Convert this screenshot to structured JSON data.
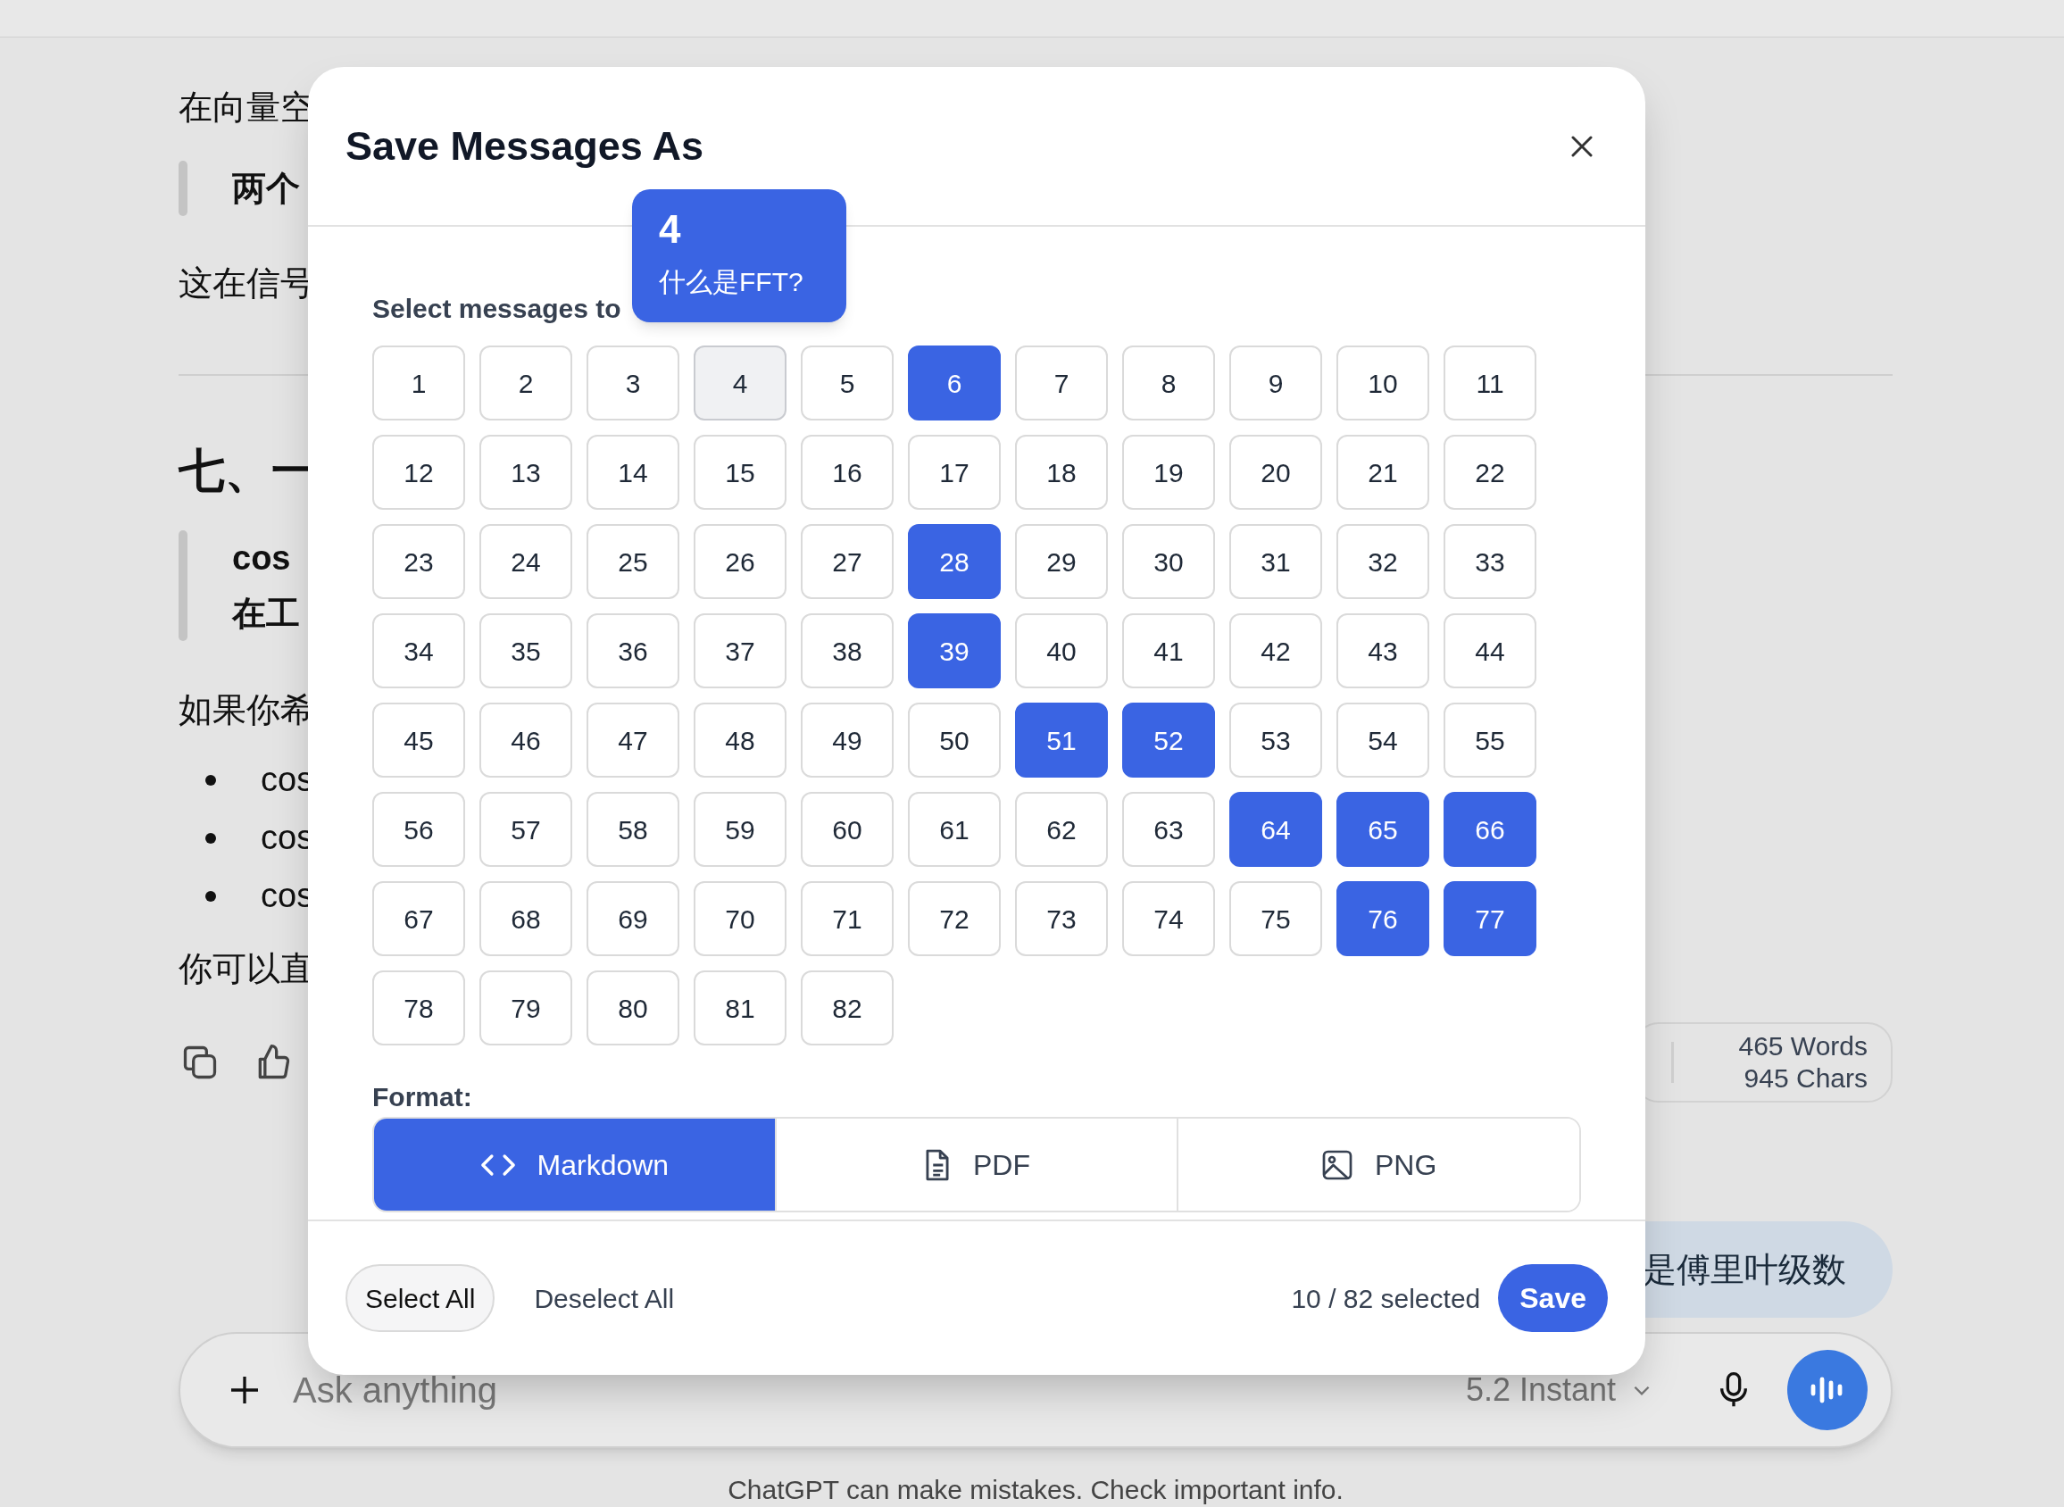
{
  "conversation": {
    "blocks": [
      {
        "kind": "para",
        "text": "在向量空"
      },
      {
        "kind": "quote",
        "lines": [
          "两个"
        ]
      },
      {
        "kind": "para",
        "text": "这在信号"
      },
      {
        "kind": "rule"
      },
      {
        "kind": "heading",
        "text": "七、一"
      },
      {
        "kind": "quote",
        "lines": [
          "cos",
          "在工"
        ]
      },
      {
        "kind": "para",
        "text": "如果你希"
      },
      {
        "kind": "bullets",
        "items": [
          "cos",
          "cos",
          "cos"
        ]
      },
      {
        "kind": "para",
        "text": "你可以直"
      }
    ]
  },
  "stats": {
    "words": "465 Words",
    "chars": "945 Chars"
  },
  "user_message": "是傅里叶级数",
  "composer": {
    "placeholder": "Ask anything",
    "model": "5.2 Instant"
  },
  "disclaimer": "ChatGPT can make mistakes. Check important info.",
  "dialog": {
    "title": "Save Messages As",
    "prompt": "Select messages to",
    "tooltip": {
      "number": "4",
      "text": "什么是FFT?"
    },
    "messages": [
      {
        "label": "1",
        "selected": false,
        "hovered": false
      },
      {
        "label": "2",
        "selected": false,
        "hovered": false
      },
      {
        "label": "3",
        "selected": false,
        "hovered": false
      },
      {
        "label": "4",
        "selected": false,
        "hovered": true
      },
      {
        "label": "5",
        "selected": false,
        "hovered": false
      },
      {
        "label": "6",
        "selected": true,
        "hovered": false
      },
      {
        "label": "7",
        "selected": false,
        "hovered": false
      },
      {
        "label": "8",
        "selected": false,
        "hovered": false
      },
      {
        "label": "9",
        "selected": false,
        "hovered": false
      },
      {
        "label": "10",
        "selected": false,
        "hovered": false
      },
      {
        "label": "11",
        "selected": false,
        "hovered": false
      },
      {
        "label": "12",
        "selected": false,
        "hovered": false
      },
      {
        "label": "13",
        "selected": false,
        "hovered": false
      },
      {
        "label": "14",
        "selected": false,
        "hovered": false
      },
      {
        "label": "15",
        "selected": false,
        "hovered": false
      },
      {
        "label": "16",
        "selected": false,
        "hovered": false
      },
      {
        "label": "17",
        "selected": false,
        "hovered": false
      },
      {
        "label": "18",
        "selected": false,
        "hovered": false
      },
      {
        "label": "19",
        "selected": false,
        "hovered": false
      },
      {
        "label": "20",
        "selected": false,
        "hovered": false
      },
      {
        "label": "21",
        "selected": false,
        "hovered": false
      },
      {
        "label": "22",
        "selected": false,
        "hovered": false
      },
      {
        "label": "23",
        "selected": false,
        "hovered": false
      },
      {
        "label": "24",
        "selected": false,
        "hovered": false
      },
      {
        "label": "25",
        "selected": false,
        "hovered": false
      },
      {
        "label": "26",
        "selected": false,
        "hovered": false
      },
      {
        "label": "27",
        "selected": false,
        "hovered": false
      },
      {
        "label": "28",
        "selected": true,
        "hovered": false
      },
      {
        "label": "29",
        "selected": false,
        "hovered": false
      },
      {
        "label": "30",
        "selected": false,
        "hovered": false
      },
      {
        "label": "31",
        "selected": false,
        "hovered": false
      },
      {
        "label": "32",
        "selected": false,
        "hovered": false
      },
      {
        "label": "33",
        "selected": false,
        "hovered": false
      },
      {
        "label": "34",
        "selected": false,
        "hovered": false
      },
      {
        "label": "35",
        "selected": false,
        "hovered": false
      },
      {
        "label": "36",
        "selected": false,
        "hovered": false
      },
      {
        "label": "37",
        "selected": false,
        "hovered": false
      },
      {
        "label": "38",
        "selected": false,
        "hovered": false
      },
      {
        "label": "39",
        "selected": true,
        "hovered": false
      },
      {
        "label": "40",
        "selected": false,
        "hovered": false
      },
      {
        "label": "41",
        "selected": false,
        "hovered": false
      },
      {
        "label": "42",
        "selected": false,
        "hovered": false
      },
      {
        "label": "43",
        "selected": false,
        "hovered": false
      },
      {
        "label": "44",
        "selected": false,
        "hovered": false
      },
      {
        "label": "45",
        "selected": false,
        "hovered": false
      },
      {
        "label": "46",
        "selected": false,
        "hovered": false
      },
      {
        "label": "47",
        "selected": false,
        "hovered": false
      },
      {
        "label": "48",
        "selected": false,
        "hovered": false
      },
      {
        "label": "49",
        "selected": false,
        "hovered": false
      },
      {
        "label": "50",
        "selected": false,
        "hovered": false
      },
      {
        "label": "51",
        "selected": true,
        "hovered": false
      },
      {
        "label": "52",
        "selected": true,
        "hovered": false
      },
      {
        "label": "53",
        "selected": false,
        "hovered": false
      },
      {
        "label": "54",
        "selected": false,
        "hovered": false
      },
      {
        "label": "55",
        "selected": false,
        "hovered": false
      },
      {
        "label": "56",
        "selected": false,
        "hovered": false
      },
      {
        "label": "57",
        "selected": false,
        "hovered": false
      },
      {
        "label": "58",
        "selected": false,
        "hovered": false
      },
      {
        "label": "59",
        "selected": false,
        "hovered": false
      },
      {
        "label": "60",
        "selected": false,
        "hovered": false
      },
      {
        "label": "61",
        "selected": false,
        "hovered": false
      },
      {
        "label": "62",
        "selected": false,
        "hovered": false
      },
      {
        "label": "63",
        "selected": false,
        "hovered": false
      },
      {
        "label": "64",
        "selected": true,
        "hovered": false
      },
      {
        "label": "65",
        "selected": true,
        "hovered": false
      },
      {
        "label": "66",
        "selected": true,
        "hovered": false
      },
      {
        "label": "67",
        "selected": false,
        "hovered": false
      },
      {
        "label": "68",
        "selected": false,
        "hovered": false
      },
      {
        "label": "69",
        "selected": false,
        "hovered": false
      },
      {
        "label": "70",
        "selected": false,
        "hovered": false
      },
      {
        "label": "71",
        "selected": false,
        "hovered": false
      },
      {
        "label": "72",
        "selected": false,
        "hovered": false
      },
      {
        "label": "73",
        "selected": false,
        "hovered": false
      },
      {
        "label": "74",
        "selected": false,
        "hovered": false
      },
      {
        "label": "75",
        "selected": false,
        "hovered": false
      },
      {
        "label": "76",
        "selected": true,
        "hovered": false
      },
      {
        "label": "77",
        "selected": true,
        "hovered": false
      },
      {
        "label": "78",
        "selected": false,
        "hovered": false
      },
      {
        "label": "79",
        "selected": false,
        "hovered": false
      },
      {
        "label": "80",
        "selected": false,
        "hovered": false
      },
      {
        "label": "81",
        "selected": false,
        "hovered": false
      },
      {
        "label": "82",
        "selected": false,
        "hovered": false
      }
    ],
    "format_label": "Format:",
    "formats": [
      {
        "label": "Markdown",
        "kind": "code",
        "selected": true
      },
      {
        "label": "PDF",
        "kind": "document",
        "selected": false
      },
      {
        "label": "PNG",
        "kind": "image",
        "selected": false
      }
    ],
    "select_all": "Select All",
    "deselect_all": "Deselect All",
    "count": "10 / 82 selected",
    "save": "Save"
  }
}
